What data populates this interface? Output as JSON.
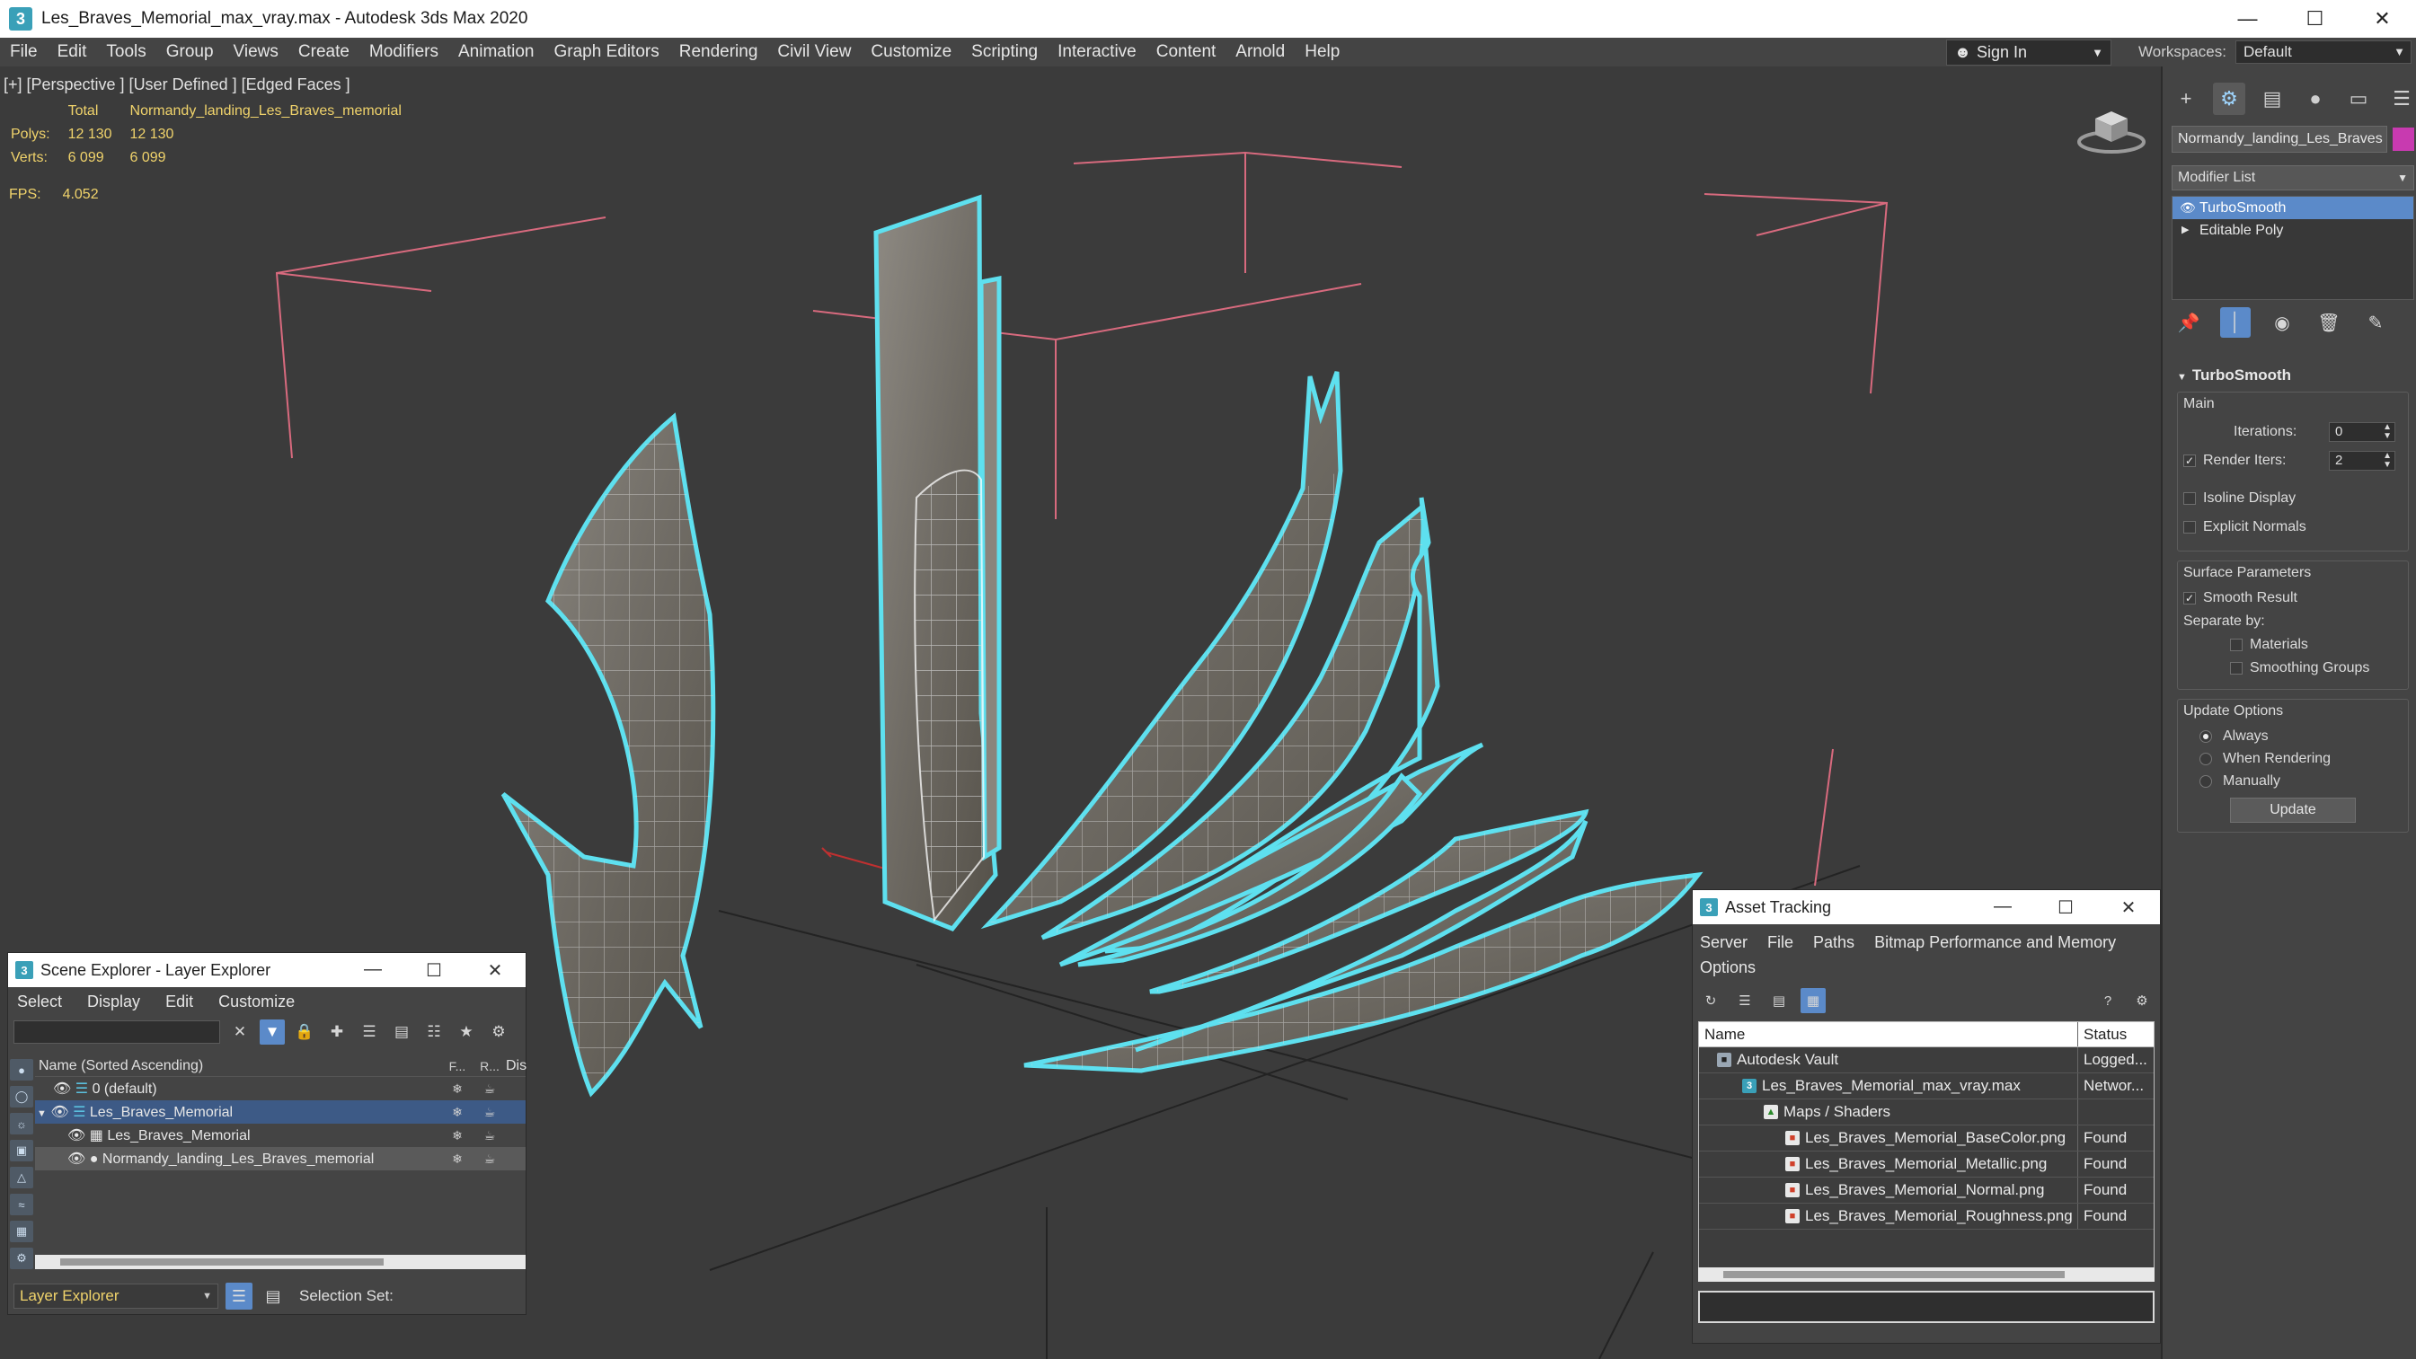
{
  "window": {
    "title": "Les_Braves_Memorial_max_vray.max - Autodesk 3ds Max 2020",
    "app_icon": "3ds-max-icon",
    "minimize": "—",
    "maximize": "☐",
    "close": "✕"
  },
  "menu": [
    "File",
    "Edit",
    "Tools",
    "Group",
    "Views",
    "Create",
    "Modifiers",
    "Animation",
    "Graph Editors",
    "Rendering",
    "Civil View",
    "Customize",
    "Scripting",
    "Interactive",
    "Content",
    "Arnold",
    "Help"
  ],
  "signin": {
    "label": "Sign In"
  },
  "workspaces": {
    "label": "Workspaces:",
    "value": "Default"
  },
  "viewport": {
    "label": "[+] [Perspective ] [User Defined ] [Edged Faces ]",
    "stats": {
      "col_total": "Total",
      "col_object": "Normandy_landing_Les_Braves_memorial",
      "polys_label": "Polys:",
      "polys_total": "12 130",
      "polys_object": "12 130",
      "verts_label": "Verts:",
      "verts_total": "6 099",
      "verts_object": "6 099"
    },
    "fps_label": "FPS:",
    "fps_value": "4.052"
  },
  "command_panel": {
    "tabs": [
      "create-icon",
      "modify-icon",
      "hierarchy-icon",
      "motion-icon",
      "display-icon",
      "utilities-icon"
    ],
    "object_name": "Normandy_landing_Les_Braves",
    "object_color": "#c83ab0",
    "modifier_list": "Modifier List",
    "stack": [
      {
        "label": "TurboSmooth",
        "selected": true
      },
      {
        "label": "Editable Poly",
        "selected": false
      }
    ],
    "turbosmooth": {
      "title": "TurboSmooth",
      "main": "Main",
      "iterations_label": "Iterations:",
      "iterations_value": "0",
      "render_iters_label": "Render Iters:",
      "render_iters_value": "2",
      "isoline": "Isoline Display",
      "explicit_normals": "Explicit Normals",
      "surface_params": "Surface Parameters",
      "smooth_result": "Smooth Result",
      "separate_by": "Separate by:",
      "materials": "Materials",
      "smoothing_groups": "Smoothing Groups",
      "update_options": "Update Options",
      "always": "Always",
      "when_rendering": "When Rendering",
      "manually": "Manually",
      "update_button": "Update"
    }
  },
  "scene_explorer": {
    "title": "Scene Explorer - Layer Explorer",
    "menu": [
      "Select",
      "Display",
      "Edit",
      "Customize"
    ],
    "col_name": "Name (Sorted Ascending)",
    "col_f": "F...",
    "col_r": "R...",
    "col_d": "Dis",
    "rows": [
      {
        "name": "0 (default)"
      },
      {
        "name": "Les_Braves_Memorial"
      },
      {
        "name": "Les_Braves_Memorial"
      },
      {
        "name": "Normandy_landing_Les_Braves_memorial"
      }
    ],
    "bottom_dropdown": "Layer Explorer",
    "selection_set": "Selection Set:"
  },
  "asset_tracking": {
    "title": "Asset Tracking",
    "menu": [
      "Server",
      "File",
      "Paths",
      "Bitmap Performance and Memory",
      "Options"
    ],
    "col_name": "Name",
    "col_status": "Status",
    "rows": [
      {
        "name": "Autodesk Vault",
        "status": "Logged..."
      },
      {
        "name": "Les_Braves_Memorial_max_vray.max",
        "status": "Networ..."
      },
      {
        "name": "Maps / Shaders",
        "status": ""
      },
      {
        "name": "Les_Braves_Memorial_BaseColor.png",
        "status": "Found"
      },
      {
        "name": "Les_Braves_Memorial_Metallic.png",
        "status": "Found"
      },
      {
        "name": "Les_Braves_Memorial_Normal.png",
        "status": "Found"
      },
      {
        "name": "Les_Braves_Memorial_Roughness.png",
        "status": "Found"
      }
    ]
  },
  "colors": {
    "selection_outline": "#5ee0ef",
    "stats_text": "#f0d36b",
    "accent": "#5b8ac9"
  }
}
